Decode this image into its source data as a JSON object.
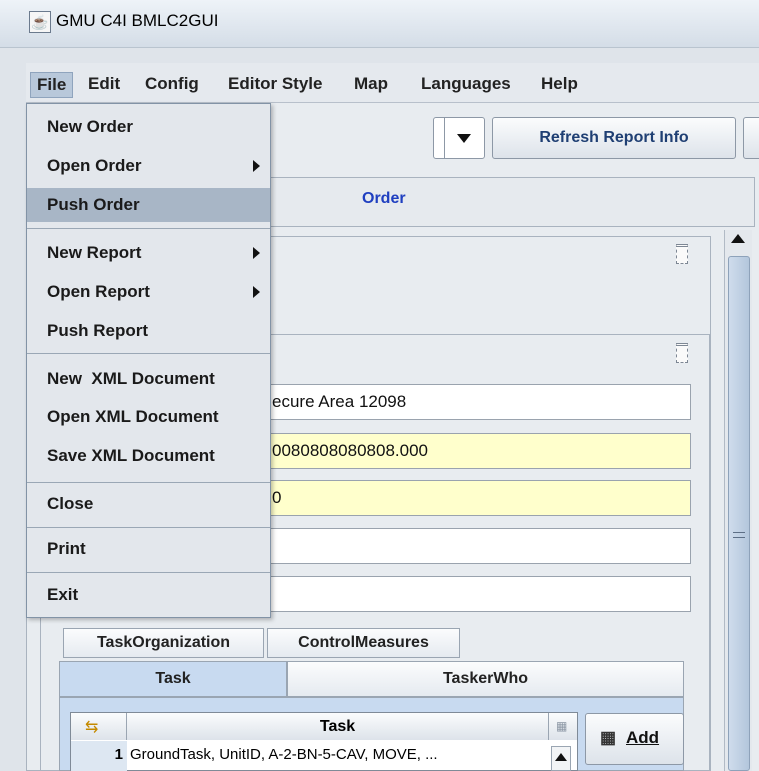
{
  "window": {
    "title": "GMU C4I BMLC2GUI",
    "icon": "java-app-icon"
  },
  "menubar": {
    "items": [
      {
        "label": "File",
        "active": true
      },
      {
        "label": "Edit"
      },
      {
        "label": "Config"
      },
      {
        "label": "Editor Style"
      },
      {
        "label": "Map"
      },
      {
        "label": "Languages"
      },
      {
        "label": "Help"
      }
    ]
  },
  "file_menu": {
    "items": [
      {
        "label": "New Order"
      },
      {
        "label": "Open Order",
        "submenu": true
      },
      {
        "label": "Push Order",
        "highlighted": true
      },
      {
        "label": "New Report",
        "submenu": true
      },
      {
        "label": "Open Report",
        "submenu": true
      },
      {
        "label": "Push Report"
      },
      {
        "label": "New  XML Document"
      },
      {
        "label": "Open XML Document"
      },
      {
        "label": "Save XML Document"
      },
      {
        "label": "Close"
      },
      {
        "label": "Print"
      },
      {
        "label": "Exit"
      }
    ]
  },
  "toolbar": {
    "refresh_label": "Refresh Report Info"
  },
  "order_tab_label": "Order",
  "fields": [
    {
      "value": "ecure Area 12098",
      "highlight": false
    },
    {
      "value": "0080808080808.000",
      "highlight": true
    },
    {
      "value": "0",
      "highlight": true
    },
    {
      "value": "",
      "highlight": false
    },
    {
      "value": "",
      "highlight": false
    }
  ],
  "tabs_row1": [
    "TaskOrganization",
    "ControlMeasures"
  ],
  "tabs_row2": [
    {
      "label": "Task",
      "selected": true
    },
    {
      "label": "TaskerWho"
    }
  ],
  "task_table": {
    "header": "Task",
    "rows": [
      {
        "index": "1",
        "value": "GroundTask, UnitID, A-2-BN-5-CAV, MOVE, ..."
      }
    ]
  },
  "add_button": {
    "label": "Add"
  },
  "colors": {
    "accent": "#1f3fc0",
    "highlight": "#a8b6c6",
    "yellow_field": "#ffffcc"
  }
}
